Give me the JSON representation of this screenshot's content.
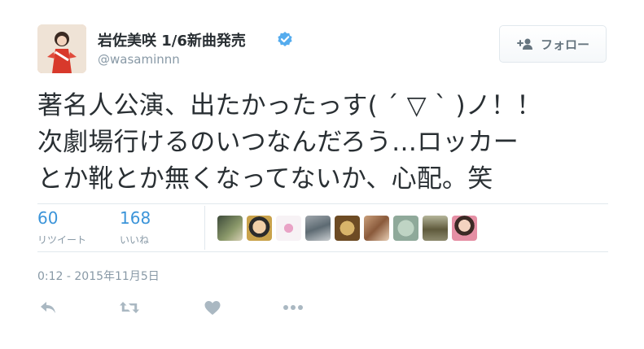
{
  "user": {
    "display_name": "岩佐美咲 1/6新曲発売",
    "screen_name": "@wasaminnn",
    "verified": true
  },
  "follow_button": {
    "label": "フォロー"
  },
  "tweet": {
    "lines": [
      "著名人公演、出たかったっす( ´ ▽ ` )ノ！！",
      "次劇場行けるのいつなんだろう…ロッカー",
      "とか靴とか無くなってないか、心配。笑"
    ]
  },
  "stats": {
    "retweets": {
      "count": "60",
      "label": "リツイート"
    },
    "likes": {
      "count": "168",
      "label": "いいね"
    }
  },
  "timestamp": "0:12 - 2015年11月5日",
  "colors": {
    "link_blue": "#3b94d9",
    "verified_blue": "#55acee",
    "muted_gray": "#8899a6",
    "action_gray": "#aab8c2",
    "border": "#e1e8ed"
  },
  "icons": {
    "reply": "reply-icon",
    "retweet": "retweet-icon",
    "like": "heart-icon",
    "more": "more-icon",
    "verified": "verified-badge-icon",
    "follow": "add-user-icon"
  }
}
